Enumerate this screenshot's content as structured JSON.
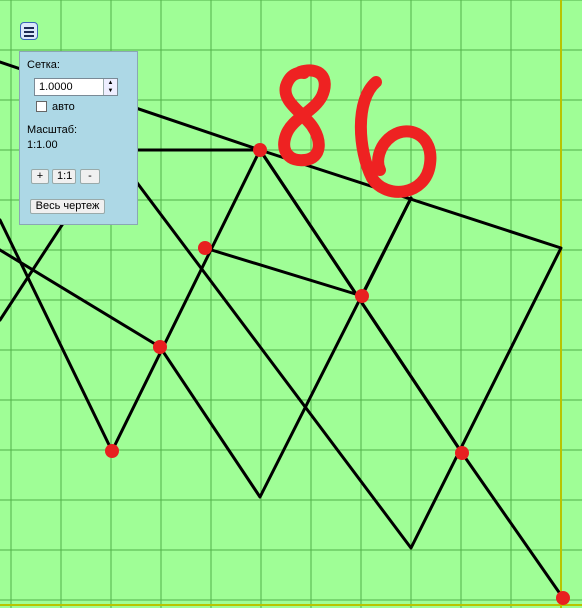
{
  "panel": {
    "grid_label": "Сетка:",
    "grid_value": "1.0000",
    "auto_label": "авто",
    "auto_checked": false,
    "scale_label": "Масштаб:",
    "scale_value": "1:1.00",
    "zoom_in_label": "+",
    "zoom_reset_label": "1:1",
    "zoom_out_label": "-",
    "fit_all_label": "Весь чертеж"
  },
  "annotation": {
    "text": "86",
    "color": "#ee2222"
  },
  "colors": {
    "background": "#9ffe96",
    "grid_line": "#52b04a",
    "border_line": "#b8c400",
    "figure_line": "#000000",
    "point": "#e82020"
  },
  "icons": {
    "menu": "hamburger-menu-icon"
  }
}
